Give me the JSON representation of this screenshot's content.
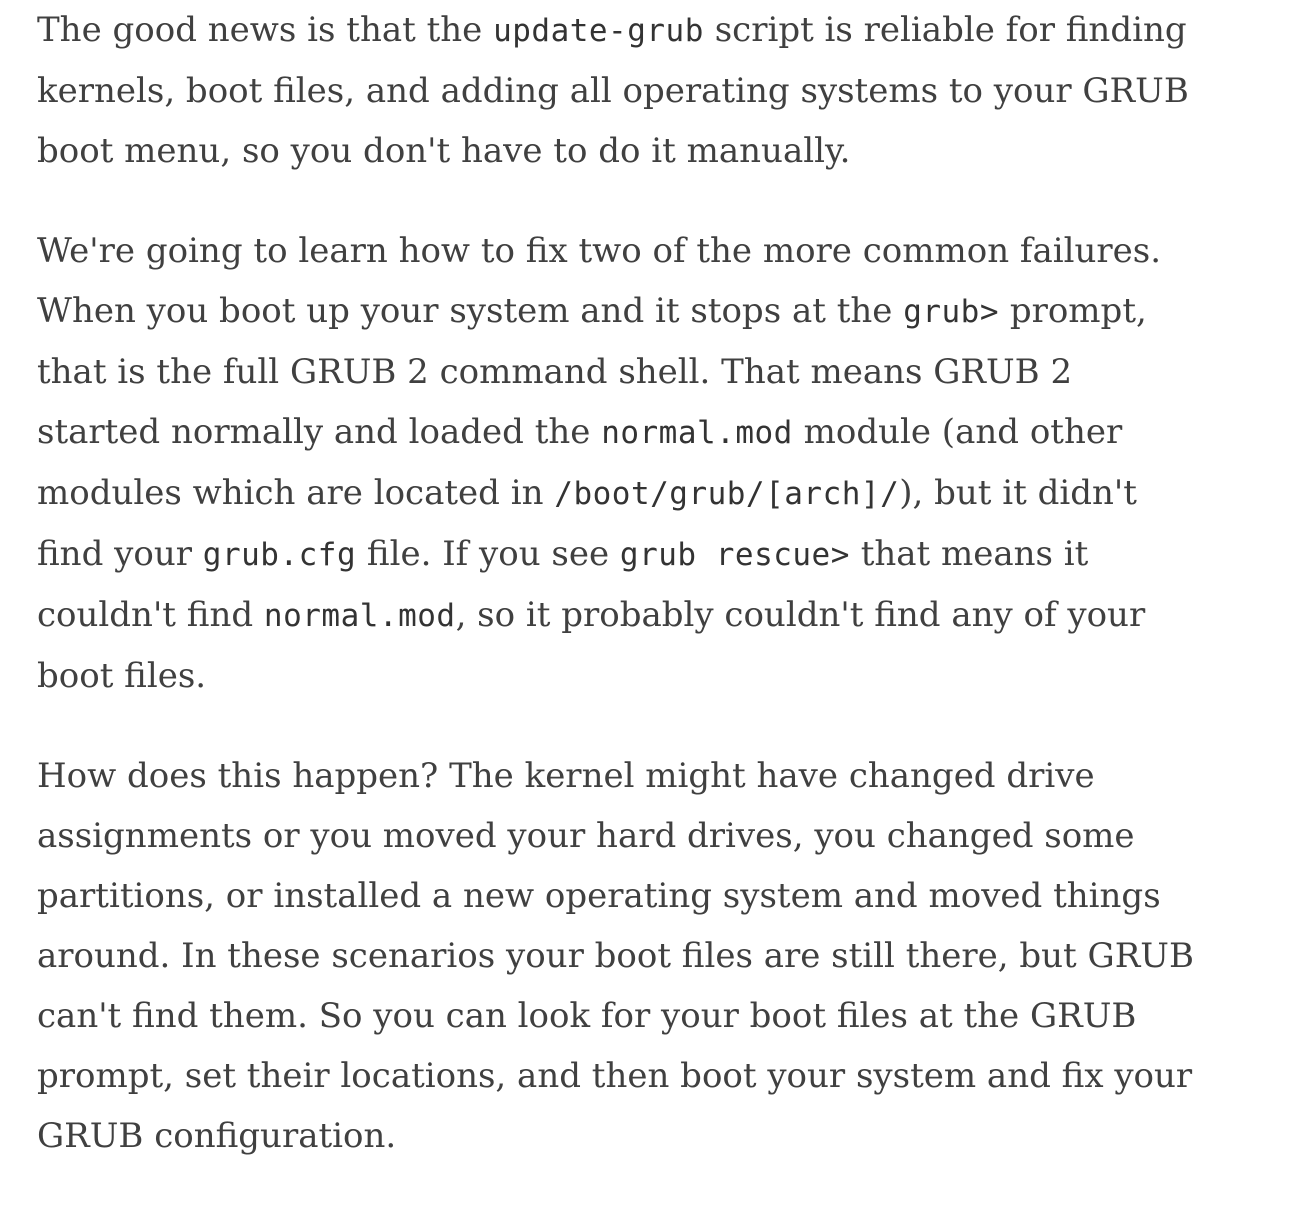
{
  "article": {
    "p1": {
      "t1": "The good news is that the ",
      "c1": "update-grub",
      "t2": " script is reliable for finding kernels, boot files, and adding all operating systems to your GRUB boot menu, so you don't have to do it manually."
    },
    "p2": {
      "t1": "We're going to learn how to fix two of the more common failures. When you boot up your system and it stops at the ",
      "c1": "grub>",
      "t2": " prompt, that is the full GRUB 2 command shell. That means GRUB 2 started normally and loaded the ",
      "c2": "normal.mod",
      "t3": " module (and other modules which are located in ",
      "c3": "/boot/grub/[arch]/",
      "t4": "), but it didn't find your ",
      "c4": "grub.cfg",
      "t5": " file. If you see ",
      "c5": "grub rescue>",
      "t6": " that means it couldn't find ",
      "c6": "normal.mod",
      "t7": ", so it probably couldn't find any of your boot files."
    },
    "p3": {
      "text": "How does this happen? The kernel might have changed drive assignments or you moved your hard drives, you changed some partitions, or installed a new operating system and moved things around. In these scenarios your boot files are still there, but GRUB can't find them. So you can look for your boot files at the GRUB prompt, set their locations, and then boot your system and fix your GRUB configuration."
    }
  }
}
